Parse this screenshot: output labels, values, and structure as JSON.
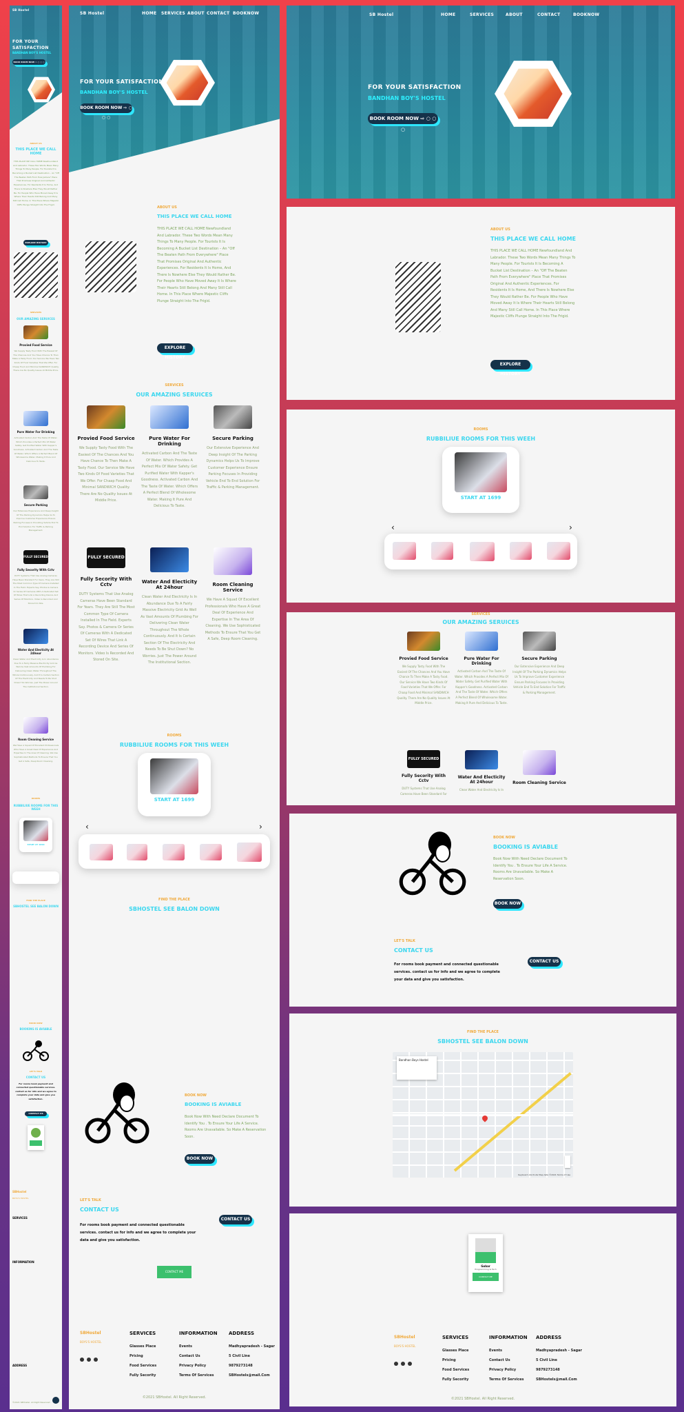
{
  "brand": {
    "name": "SB Hostel",
    "subtitle": "BOYS'S HOSTEL"
  },
  "nav": [
    "HOME",
    "SERVICES",
    "ABOUT",
    "CONTACT",
    "BOOKNOW"
  ],
  "hero": {
    "title": "FOR YOUR SATISFACTION",
    "subtitle": "BANDHAN BOY'S HOSTEL",
    "button": "BOOK ROOM NOW ⇨ ○ ○ ○"
  },
  "about": {
    "kicker": "ABOUT US",
    "heading": "THIS PLACE WE CALL HOME",
    "text": "THIS PLACE WE CALL HOME Newfoundland And Labrador. These Two Words Mean Many Things To Many People. For Tourists It Is Becoming A Bucket List Destination – An \"Off The Beaten Path From Everywhere\" Place That Promises Original And Authentic Experiences. For Residents It Is Home, And There Is Nowhere Else They Would Rather Be. For People Who Have Moved Away It Is Where Their Hearts Still Belong And Many Still Call Home. In This Place Where Majestic Cliffs Plunge Straight Into The Frigid.",
    "button": "EXPLORE HISTORY"
  },
  "services": {
    "kicker": "SERVICES",
    "heading": "OUR AMAZING SERUICES",
    "items": [
      {
        "title": "Provied Food Service",
        "text": "We Supply Tasty Food With The Easiest Of The Chances And You Have Chance To Then Make A Tasty Food. Our Service We Have Two Kinds Of Food Varieties That We Offer. For Chaap Food And Minimal SANDWICH Quality. There Are No Quality Issues At Middle Price."
      },
      {
        "title": "Pure Water For Drinking",
        "text": "Activated Carbon And The Taste Of Water. Which Provides A Perfect Mix Of Water Safety. Get Purified Water With Kapper's Goodness. Activated Carbon And The Taste Of Water. Which Offers A Perfect Blend Of Wholesome Water. Making It Pure And Delicious To Taste."
      },
      {
        "title": "Secure Parking",
        "text": "Our Extensive Experience And Deep Insight Of The Parking Dynamics Helps Us To Improve Customer Experience Ensure Parking Focuses In Providing Vehicle End To End Solution For Traffic & Parking Management."
      },
      {
        "title": "Fully Secority With Cctv",
        "text": "DUTY Systems That Use Analog Cameras Have Been Standard For Years. They Are Still The Most Common Type Of Camera Installed In The Field. Experts Say. Photos & Camera Or Series Of Cameras With A Dedicated Set Of Wires That Link A Recording Device And Series Of Monitors. Video Is Recorded And Stored On Site."
      },
      {
        "title": "Water And Electicity At 24hour",
        "text": "Clean Water And Electricity Is In Abundance Due To A Fairly Massive Electricity Grid As Well As Vast Amounts Of Plumbing For Delivering Clean Water Throughout The Whole Continuously. And It Is Certain Section Of The Electricity And Needs To Be Shut Down? No Worries. Just The Power Around The Institutional Section."
      },
      {
        "title": "Room Cleaning Service",
        "text": "We Have A Squad Of Excellent Professionals Who Have A Great Deal Of Experience And Expertise In The Area Of Cleaning. We Use Sophisticated Methods To Ensure That You Get A Safe, Deep Room Cleaning."
      }
    ],
    "secured_label": "FULLY SECURED"
  },
  "rooms": {
    "kicker": "ROOMS",
    "heading": "RUBBILIUE ROOMS FOR THIS WEEH",
    "card_label": "START AT 1699",
    "prev": "‹",
    "next": "›"
  },
  "place": {
    "kicker": "FIND THE PLACE",
    "heading": "SBHOSTEL SEE BALON DOWN"
  },
  "booking": {
    "kicker": "BOOK NOW",
    "heading": "BOOKING IS AVIABLE",
    "text": "Book Now With Need Declare Document To Identify You . To Ensure Your Life A Service. Rooms Are Unavailable. So Make A Reservation Soon.",
    "button": "BOOK NOW"
  },
  "contact": {
    "kicker": "LET'S TALK",
    "heading": "CONTACT US",
    "text": "For rooms book payment and connected questionable services. contact us for info and we agree to complete your data and give you satisfaction.",
    "button": "CONTACT US"
  },
  "profile": {
    "name": "Gobar",
    "role": "Programming & Tech",
    "button": "CONTACT ME"
  },
  "footer": {
    "brand": "SBHostel",
    "brand_sub": "BOYS'S HOSTEL",
    "services_h": "SERVICES",
    "services": [
      "Glasses Place",
      "Pricing",
      "Food Services",
      "Fully Secority"
    ],
    "info_h": "INFORMATION",
    "info": [
      "Events",
      "Contact Us",
      "Privacy Policy",
      "Terms Of Services"
    ],
    "address_h": "ADDRESS",
    "address": [
      "Madhyapradesh - Sagar",
      "5 Civil Line",
      "9879273148",
      "SBHostels@mail.Com"
    ],
    "copyright": "©2021 SBHostel. All Right Reserved."
  },
  "map": {
    "title": "Bandhan Boys Hostel",
    "attribution": "Keyboard shortcuts  Map data ©2021  Terms of Use"
  },
  "colors": {
    "accent": "#2ee7ff",
    "orange": "#f0a93a",
    "dark": "#15324a",
    "text_green": "#7da65d"
  }
}
